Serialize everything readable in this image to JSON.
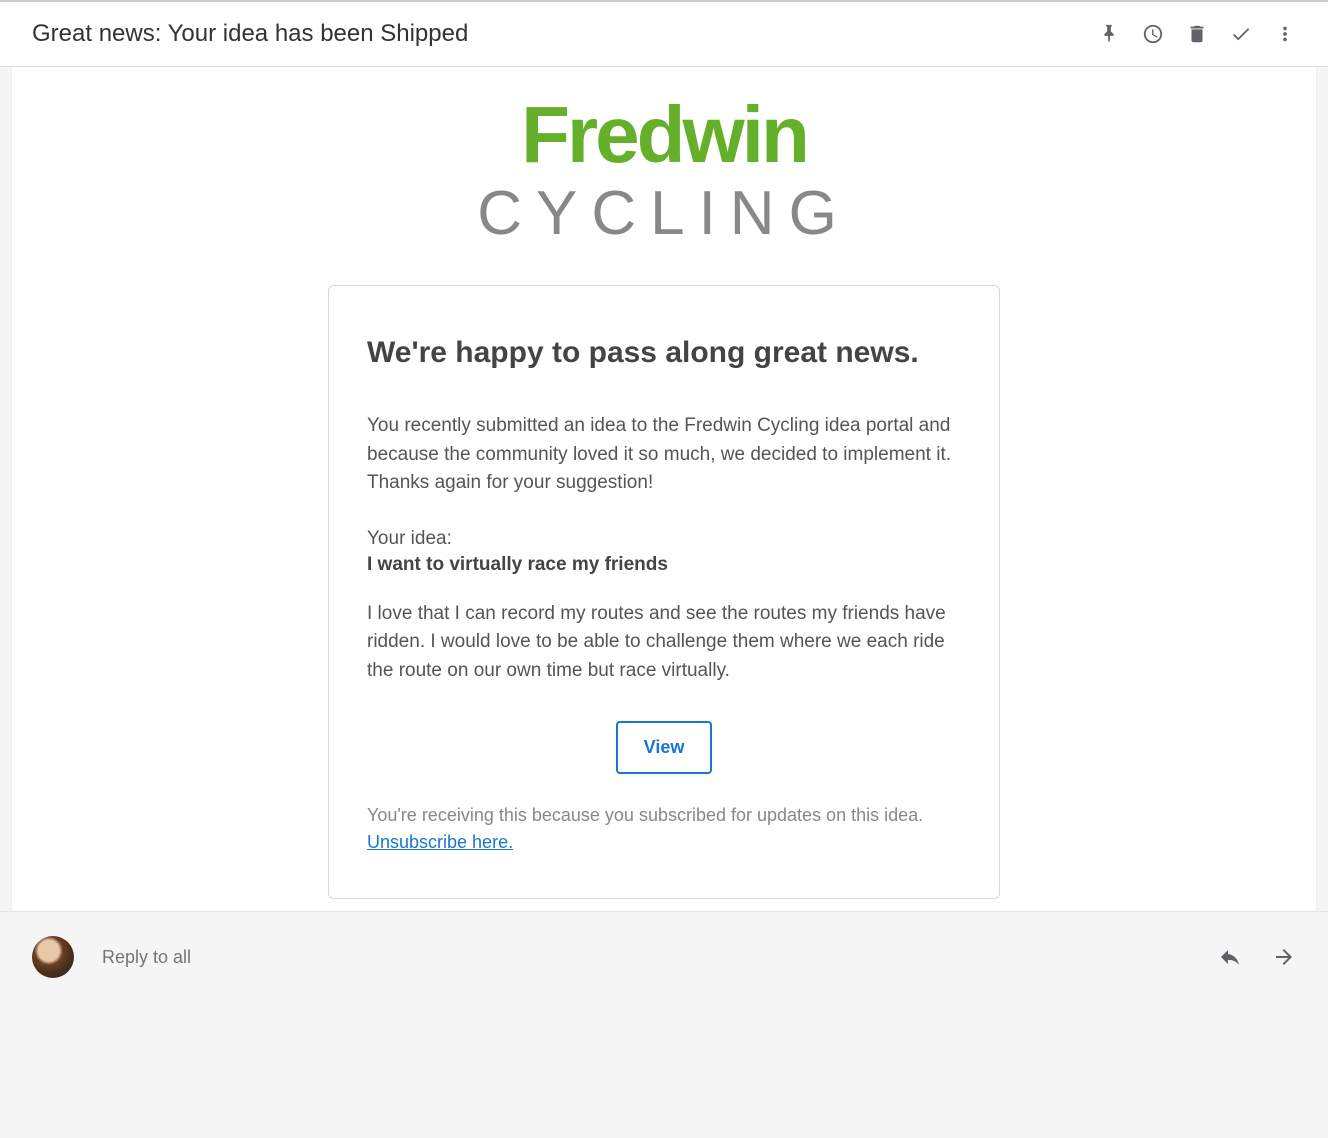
{
  "header": {
    "subject": "Great news: Your idea has been Shipped"
  },
  "logo": {
    "top": "Fredwin",
    "bottom": "CYCLING"
  },
  "card": {
    "heading": "We're happy to pass along great news.",
    "intro": "You recently submitted an idea to the Fredwin Cycling idea portal and because the community loved it so much, we decided to implement it. Thanks again for your suggestion!",
    "idea_label": "Your idea:",
    "idea_title": "I want to virtually race my friends",
    "idea_desc": "I love that I can record my routes and see the routes my friends have ridden. I would love to be able to challenge them where we each ride the route on our own time but race virtually.",
    "view_button": "View",
    "footer_prefix": "You're receiving this because you subscribed for updates on this idea. ",
    "unsubscribe": "Unsubscribe here."
  },
  "reply": {
    "placeholder": "Reply to all"
  }
}
